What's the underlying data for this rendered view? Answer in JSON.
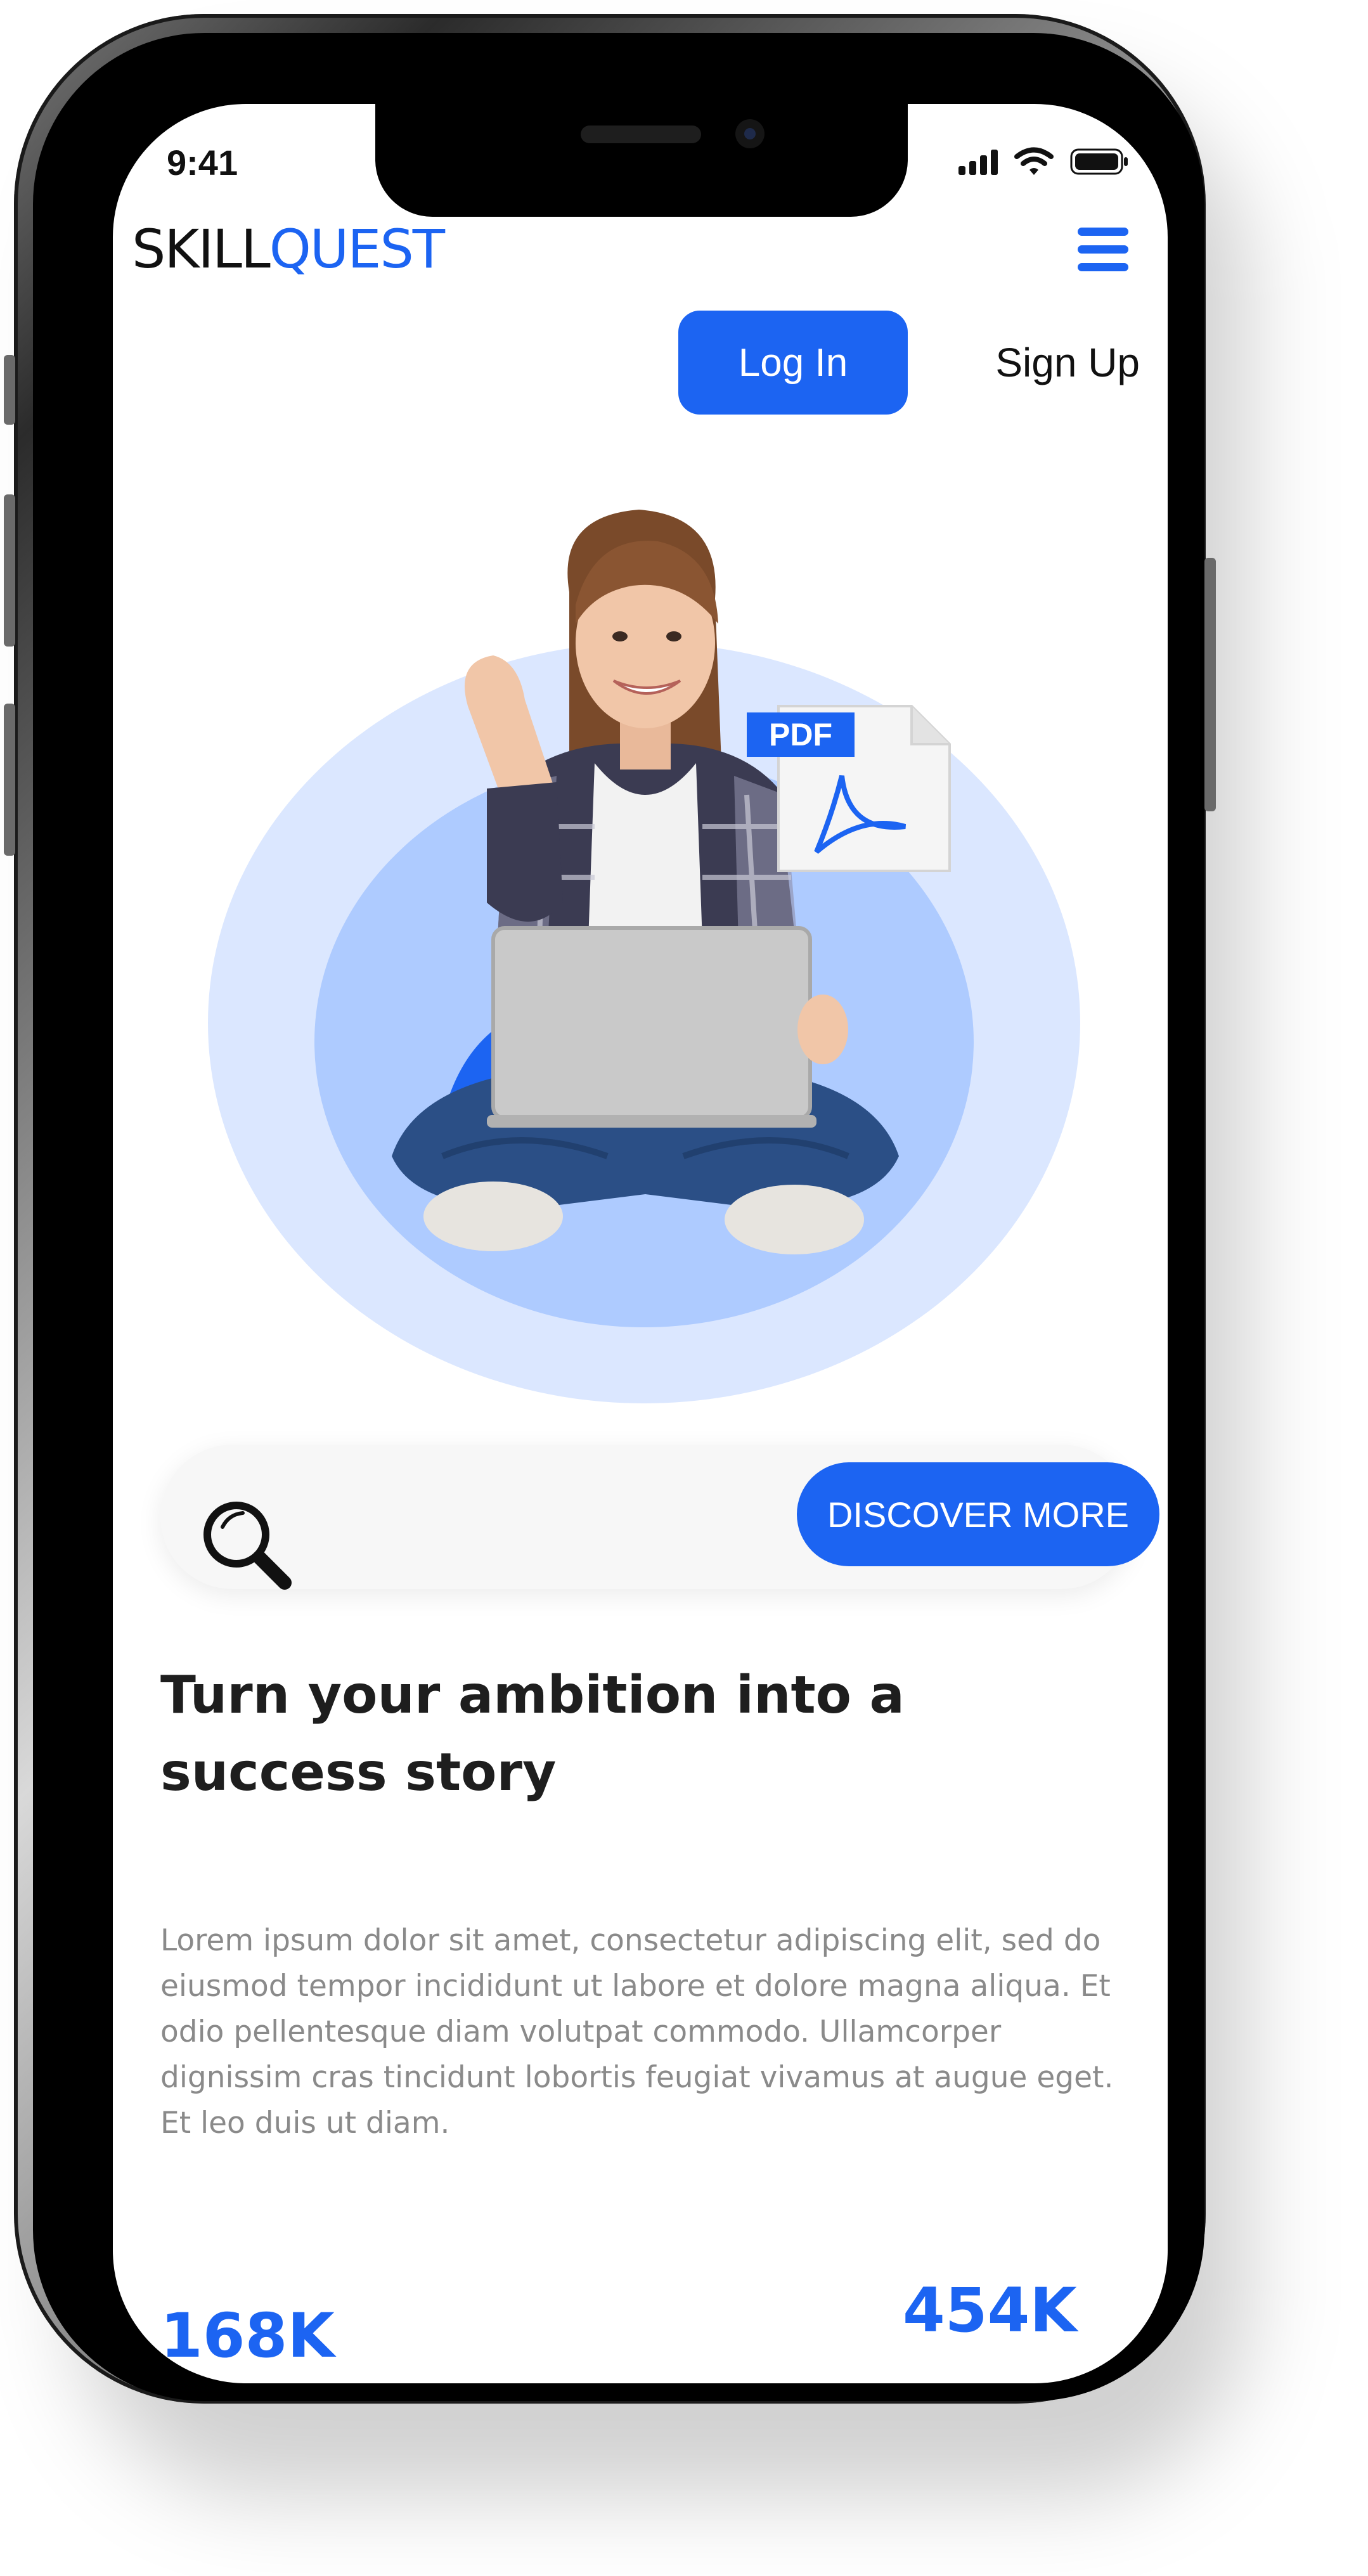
{
  "status_bar": {
    "time": "9:41",
    "icons": [
      "cellular-signal-icon",
      "wifi-icon",
      "battery-icon"
    ]
  },
  "header": {
    "logo_part1": "SKILL",
    "logo_part2": "QUEST",
    "menu_icon": "hamburger-menu-icon"
  },
  "auth": {
    "login_label": "Log In",
    "signup_label": "Sign Up"
  },
  "hero": {
    "badge_label": "PDF",
    "image": "woman-with-laptop-illustration"
  },
  "search": {
    "icon": "search-icon",
    "button_label": "DISCOVER MORE"
  },
  "content": {
    "headline_line1": "Turn your ambition into a",
    "headline_line2": "success story",
    "body": "Lorem ipsum dolor sit amet, consectetur adipiscing elit, sed do eiusmod tempor incididunt ut labore et dolore magna aliqua. Et odio pellentesque diam volutpat commodo. Ullamcorper dignissim cras tincidunt lobortis feugiat vivamus at augue eget. Et leo duis ut diam."
  },
  "stats": {
    "stat1": "168K",
    "stat2": "454K"
  },
  "colors": {
    "accent": "#1c64f2",
    "circle_outer": "#dbe7ff",
    "circle_inner": "#aecbff"
  }
}
